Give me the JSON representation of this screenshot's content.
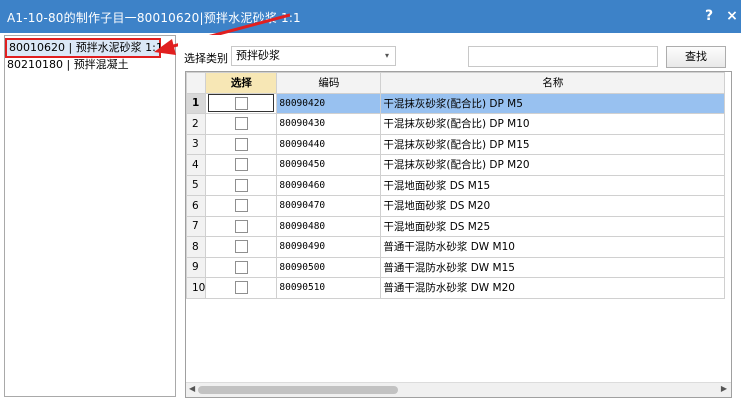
{
  "window": {
    "title": "A1-10-80的制作子目一80010620|预拌水泥砂浆 1:1",
    "help_label": "?",
    "close_label": "×"
  },
  "tree": {
    "items": [
      {
        "label": "80010620 | 预拌水泥砂浆 1:1",
        "selected": true
      },
      {
        "label": "80210180 | 预拌混凝土",
        "selected": false
      }
    ]
  },
  "filter": {
    "label": "选择类别",
    "value": "预拌砂浆",
    "search_value": "",
    "search_button": "查找"
  },
  "grid": {
    "columns": [
      "",
      "选择",
      "编码",
      "名称"
    ],
    "rows": [
      {
        "num": "1",
        "code": "80090420",
        "name": "干混抹灰砂浆(配合比) DP M5",
        "checked": false
      },
      {
        "num": "2",
        "code": "80090430",
        "name": "干混抹灰砂浆(配合比) DP M10",
        "checked": false
      },
      {
        "num": "3",
        "code": "80090440",
        "name": "干混抹灰砂浆(配合比) DP M15",
        "checked": false
      },
      {
        "num": "4",
        "code": "80090450",
        "name": "干混抹灰砂浆(配合比) DP M20",
        "checked": false
      },
      {
        "num": "5",
        "code": "80090460",
        "name": "干混地面砂浆 DS M15",
        "checked": false
      },
      {
        "num": "6",
        "code": "80090470",
        "name": "干混地面砂浆 DS M20",
        "checked": false
      },
      {
        "num": "7",
        "code": "80090480",
        "name": "干混地面砂浆 DS M25",
        "checked": false
      },
      {
        "num": "8",
        "code": "80090490",
        "name": "普通干混防水砂浆 DW M10",
        "checked": false
      },
      {
        "num": "9",
        "code": "80090500",
        "name": "普通干混防水砂浆 DW M15",
        "checked": false
      },
      {
        "num": "10",
        "code": "80090510",
        "name": "普通干混防水砂浆 DW M20",
        "checked": false
      }
    ],
    "selected_row": 0
  },
  "colors": {
    "titlebar": "#3d82c8",
    "selection": "#98c1f0",
    "annotation_red": "#e11f1f",
    "select_header": "#f7e7b5"
  }
}
